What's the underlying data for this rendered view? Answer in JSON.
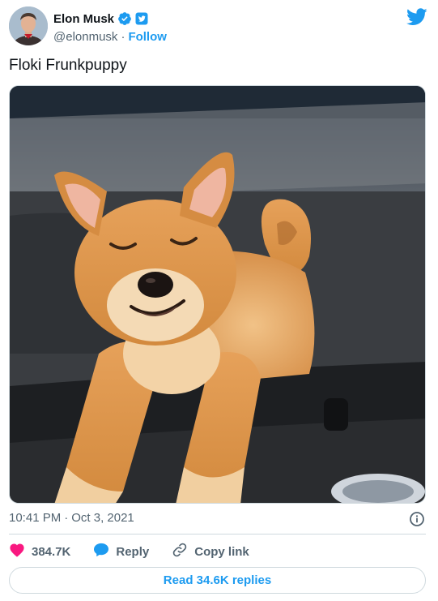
{
  "author": {
    "display_name": "Elon Musk",
    "handle": "@elonmusk",
    "separator": "·",
    "follow_label": "Follow",
    "verified": true
  },
  "tweet": {
    "text": "Floki Frunkpuppy",
    "time": "10:41 PM",
    "date_separator": "·",
    "date": "Oct 3, 2021"
  },
  "actions": {
    "like_count": "384.7K",
    "reply_label": "Reply",
    "copy_link_label": "Copy link"
  },
  "read_replies_label": "Read 34.6K replies",
  "icons": {
    "verified": "verified-badge-icon",
    "twitter": "twitter-bird-icon",
    "info": "info-icon",
    "like": "heart-icon",
    "reply": "speech-bubble-icon",
    "copy_link": "link-icon"
  },
  "colors": {
    "brand_blue": "#1d9bf0",
    "like_pink": "#f91880",
    "text_primary": "#0f1419",
    "text_secondary": "#536471",
    "border": "#cfd9de"
  }
}
